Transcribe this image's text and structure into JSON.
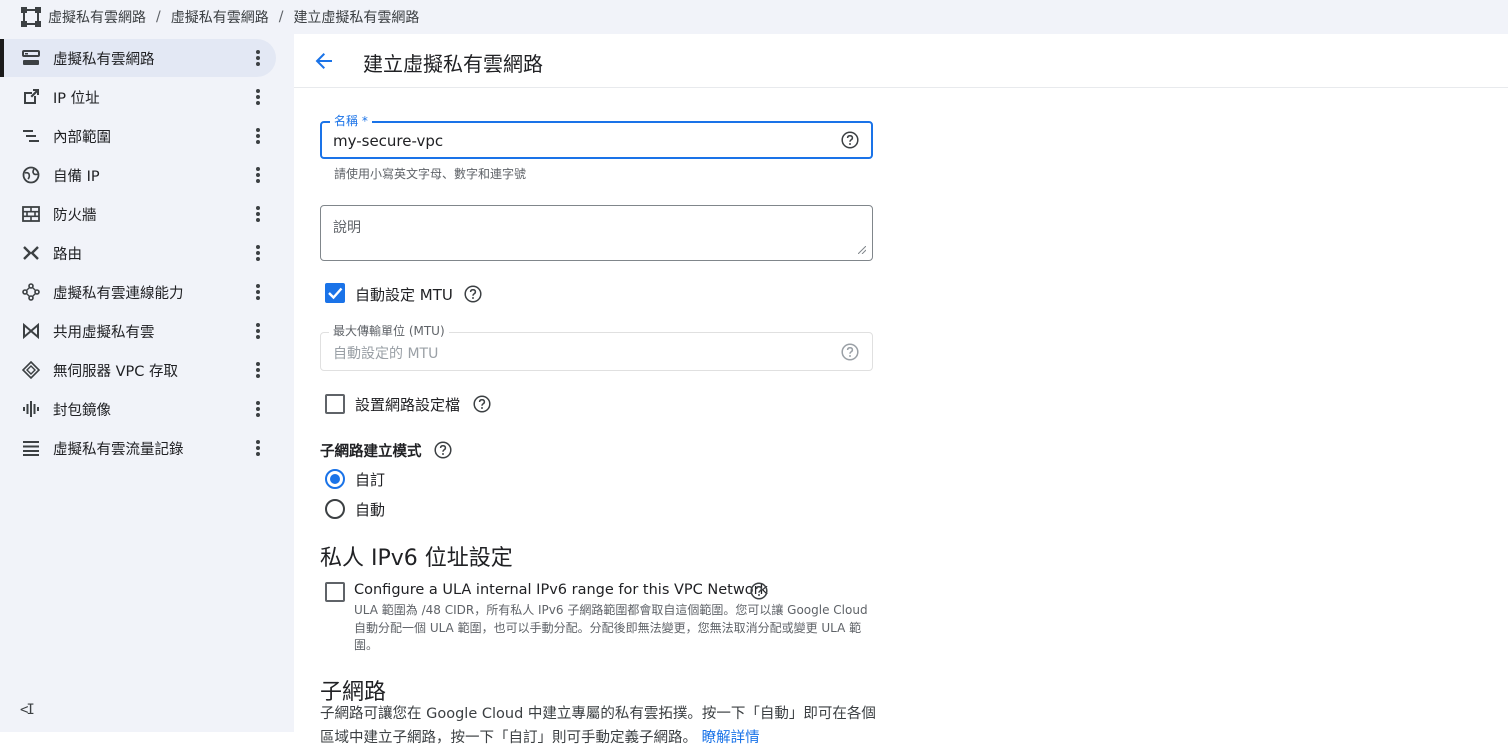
{
  "breadcrumb": {
    "items": [
      "虛擬私有雲網路",
      "虛擬私有雲網路",
      "建立虛擬私有雲網路"
    ],
    "separator": "/"
  },
  "sidebar": {
    "items": [
      {
        "label": "虛擬私有雲網路",
        "icon": "vpc-network-icon",
        "active": true
      },
      {
        "label": "IP 位址",
        "icon": "ip-address-icon"
      },
      {
        "label": "內部範圍",
        "icon": "internal-range-icon"
      },
      {
        "label": "自備 IP",
        "icon": "globe-icon"
      },
      {
        "label": "防火牆",
        "icon": "firewall-icon"
      },
      {
        "label": "路由",
        "icon": "routes-icon"
      },
      {
        "label": "虛擬私有雲連線能力",
        "icon": "connectivity-icon"
      },
      {
        "label": "共用虛擬私有雲",
        "icon": "shared-vpc-icon"
      },
      {
        "label": "無伺服器 VPC 存取",
        "icon": "serverless-icon"
      },
      {
        "label": "封包鏡像",
        "icon": "packet-mirroring-icon"
      },
      {
        "label": "虛擬私有雲流量記錄",
        "icon": "flow-logs-icon"
      }
    ],
    "collapse_glyph": "<I"
  },
  "header": {
    "title": "建立虛擬私有雲網路"
  },
  "form": {
    "name": {
      "label": "名稱 *",
      "value": "my-secure-vpc",
      "hint": "請使用小寫英文字母、數字和連字號"
    },
    "description": {
      "placeholder": "說明"
    },
    "auto_mtu": {
      "label": "自動設定 MTU",
      "checked": true
    },
    "mtu": {
      "label": "最大傳輸單位 (MTU)",
      "placeholder": "自動設定的 MTU"
    },
    "network_profile": {
      "label": "設置網路設定檔",
      "checked": false
    },
    "subnet_mode": {
      "label": "子網路建立模式",
      "options": [
        "自訂",
        "自動"
      ],
      "selected": "自訂"
    },
    "ipv6": {
      "heading": "私人 IPv6 位址設定",
      "ula_label": "Configure a ULA internal IPv6 range for this VPC Network",
      "ula_checked": false,
      "ula_desc": "ULA 範圍為 /48 CIDR，所有私人 IPv6 子網路範圍都會取自這個範圍。您可以讓 Google Cloud 自動分配一個 ULA 範圍，也可以手動分配。分配後即無法變更，您無法取消分配或變更 ULA 範圍。"
    },
    "subnets": {
      "heading": "子網路",
      "desc": "子網路可讓您在 Google Cloud 中建立專屬的私有雲拓撲。按一下「自動」即可在各個區域中建立子網路，按一下「自訂」則可手動定義子網路。",
      "learn_more": "瞭解詳情"
    }
  },
  "colors": {
    "accent": "#1a73e8",
    "sidebar_bg": "#f1f3f9",
    "active_bg": "#e3e8f4"
  }
}
